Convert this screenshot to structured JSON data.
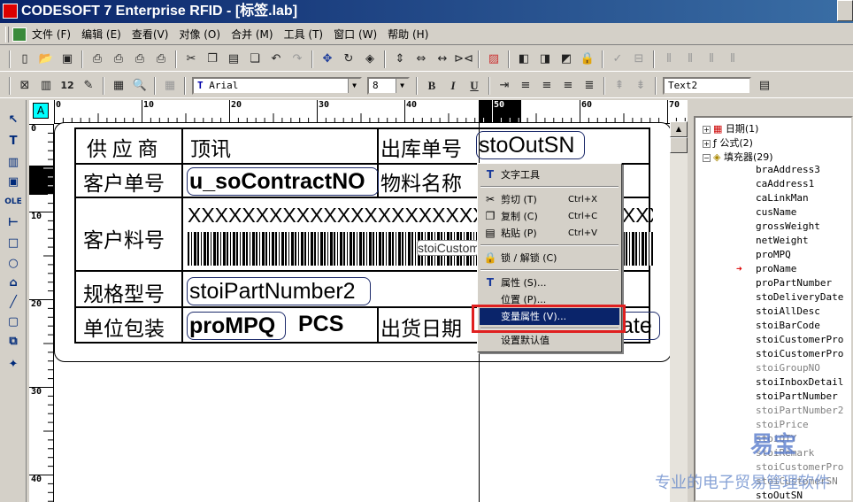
{
  "title": "CODESOFT 7 Enterprise RFID - [标签.lab]",
  "menu": [
    "文件 (F)",
    "编辑 (E)",
    "查看(V)",
    "对像 (O)",
    "合并 (M)",
    "工具 (T)",
    "窗口 (W)",
    "帮助 (H)"
  ],
  "format_bar": {
    "font_name": "Arial",
    "font_size": "8",
    "bold": "B",
    "italic": "I",
    "underline": "U",
    "text_box": "Text2"
  },
  "ruler": {
    "h": [
      "0",
      "10",
      "20",
      "30",
      "40",
      "50",
      "60",
      "70"
    ],
    "v": [
      "0",
      "10",
      "20",
      "30",
      "40"
    ]
  },
  "left_tools": [
    "T",
    "OLE"
  ],
  "label": {
    "r1": {
      "c1": "供 应 商",
      "c2": "顶讯",
      "c3": "出库单号",
      "c4": "stoOutSN"
    },
    "r2": {
      "c1": "客户单号",
      "c2": "u_soContractNO",
      "c3": "物料名称"
    },
    "r3": {
      "c1": "客户料号",
      "c2": "XXXXXXXXXXXXXXXXXXXXXXXXXXXXXXXXXXXXXXXX",
      "c3": "stoiCustom"
    },
    "r4": {
      "c1": "规格型号",
      "c2": "stoiPartNumber2"
    },
    "r5": {
      "c1": "单位包装",
      "c2": "proMPQ",
      "c2b": "PCS",
      "c3": "出货日期",
      "c4": "ate"
    }
  },
  "context_menu": {
    "text_tool": "文字工具",
    "cut": "剪切 (T)",
    "cut_sc": "Ctrl+X",
    "copy": "复制 (C)",
    "copy_sc": "Ctrl+C",
    "paste": "粘贴 (P)",
    "paste_sc": "Ctrl+V",
    "lock": "锁 / 解锁 (C)",
    "props": "属性 (S)...",
    "position": "位置 (P)...",
    "var_props": "变量属性 (V)...",
    "set_default": "设置默认值"
  },
  "tree": {
    "date": "日期(1)",
    "formula": "公式(2)",
    "filler": "填充器(29)",
    "items": [
      "braAddress3",
      "caAddress1",
      "caLinkMan",
      "cusName",
      "grossWeight",
      "netWeight",
      "proMPQ",
      "proName",
      "proPartNumber",
      "stoDeliveryDate",
      "stoiAllDesc",
      "stoiBarCode",
      "stoiCustomerPro",
      "stoiCustomerPro",
      "stoiGroupNO",
      "stoiInboxDetail",
      "stoiPartNumber",
      "stoiPartNumber2",
      "stoiPrice",
      "stoiQTY",
      "stoiRemark",
      "stoiCustomerPro",
      "stoiCustomerSN",
      "stoOutSN"
    ]
  },
  "watermark": {
    "logo": "易宝",
    "slogan": "专业的电子贸易管理软件"
  }
}
